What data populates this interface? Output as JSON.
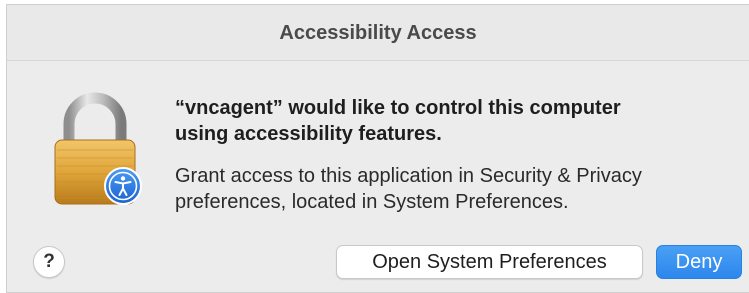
{
  "dialog": {
    "title": "Accessibility Access",
    "headline_line1": "“vncagent” would like to control this computer",
    "headline_line2": "using accessibility features.",
    "info_line1": "Grant access to this application in Security & Privacy",
    "info_line2": "preferences, located in System Preferences."
  },
  "buttons": {
    "help_label": "?",
    "open_prefs_label": "Open System Preferences",
    "deny_label": "Deny"
  },
  "icons": {
    "main": "lock-icon",
    "badge": "accessibility-icon"
  },
  "colors": {
    "accent": "#2d86ec",
    "lock_gold": "#e0a63a",
    "badge_blue": "#1f73e0"
  }
}
